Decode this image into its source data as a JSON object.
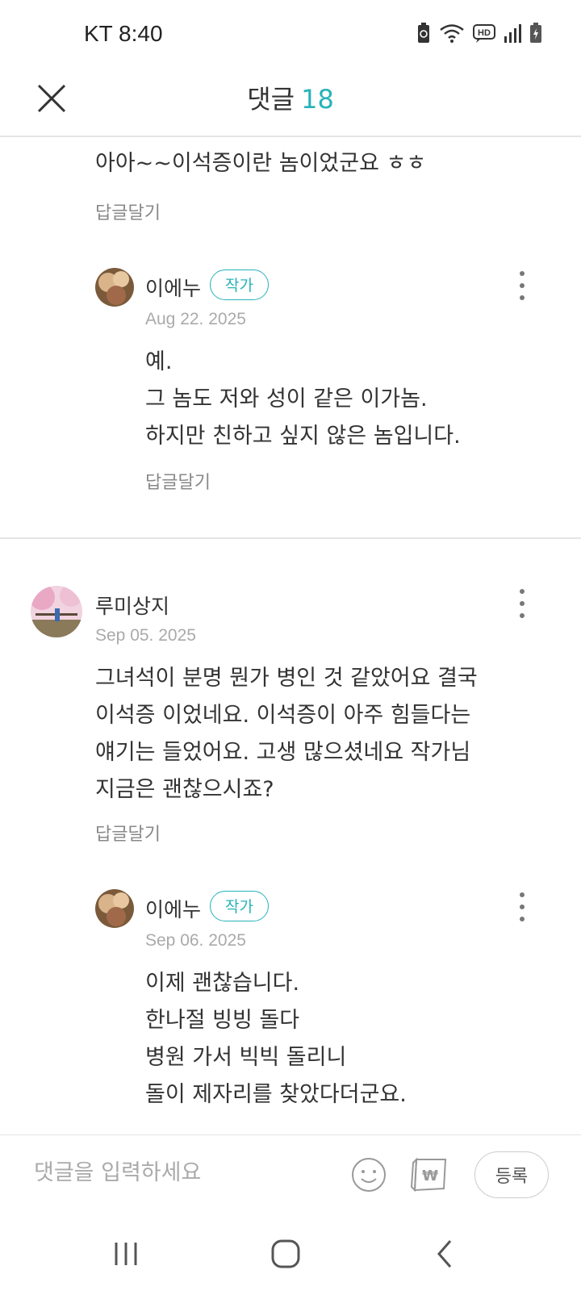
{
  "status_bar": {
    "carrier_time": "KT 8:40",
    "icons": [
      "recycle-battery-icon",
      "wifi-icon",
      "hd-call-icon",
      "signal-icon",
      "battery-charging-icon"
    ]
  },
  "header": {
    "title": "댓글",
    "count": "18",
    "close_icon": "close-icon",
    "accent_color": "#27b3b9"
  },
  "comments": [
    {
      "text": "아아~~이석증이란 놈이었군요 ㅎㅎ",
      "reply_label": "답글달기",
      "replies": [
        {
          "author": "이에누",
          "badge": "작가",
          "date": "Aug 22. 2025",
          "lines": [
            "예.",
            "그 놈도 저와 성이 같은 이가놈.",
            "하지만 친하고 싶지 않은 놈입니다."
          ],
          "reply_label": "답글달기"
        }
      ]
    },
    {
      "author": "루미상지",
      "date": "Sep 05. 2025",
      "lines": [
        "그녀석이 분명 뭔가 병인 것 같았어요 결국",
        "이석증 이었네요. 이석증이 아주 힘들다는",
        "얘기는 들었어요. 고생 많으셨네요 작가님",
        "지금은 괜찮으시죠?"
      ],
      "reply_label": "답글달기",
      "replies": [
        {
          "author": "이에누",
          "badge": "작가",
          "date": "Sep 06. 2025",
          "lines": [
            "이제 괜찮습니다.",
            "한나절 빙빙 돌다",
            "병원 가서 빅빅 돌리니",
            "돌이 제자리를 찾았다더군요."
          ]
        }
      ]
    }
  ],
  "input_bar": {
    "placeholder": "댓글을 입력하세요",
    "submit_label": "등록",
    "emoji_icon": "emoji-icon",
    "coin_icon": "won-coin-icon"
  },
  "nav_bar": {
    "icons": [
      "recent-apps-icon",
      "home-icon",
      "back-icon"
    ]
  }
}
